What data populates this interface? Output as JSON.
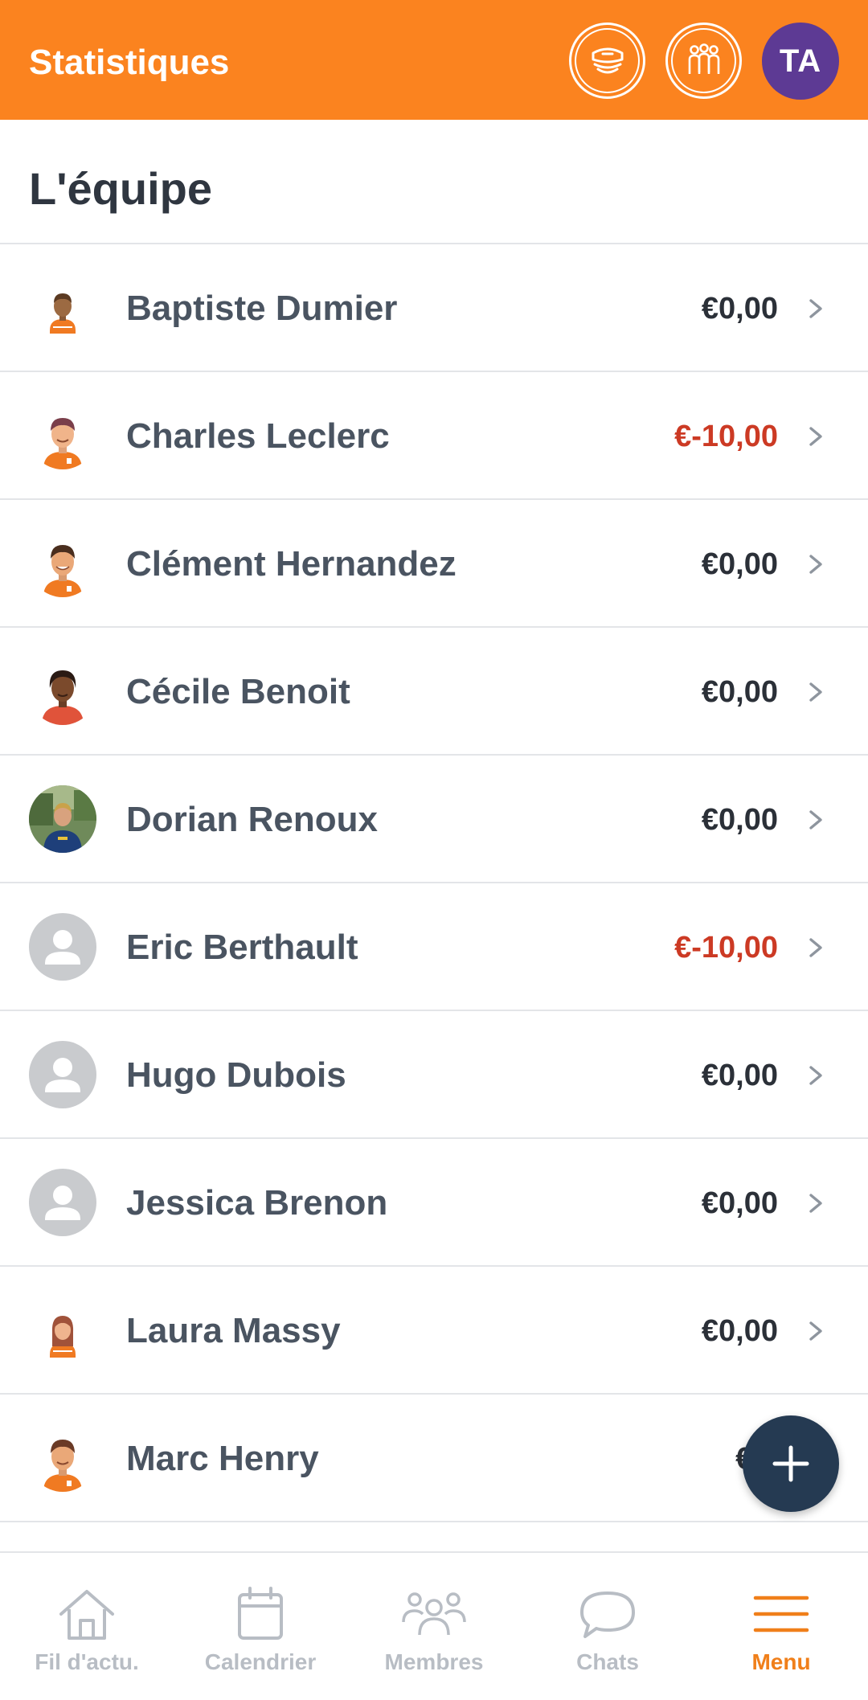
{
  "header": {
    "title": "Statistiques",
    "user_initials": "TA",
    "icons": [
      "coach-badge-icon",
      "team-group-icon"
    ]
  },
  "section": {
    "title": "L'équipe"
  },
  "members": [
    {
      "name": "Baptiste Dumier",
      "amount": "€0,00",
      "negative": false,
      "avatar": "player-avatar-small"
    },
    {
      "name": "Charles Leclerc",
      "amount": "€-10,00",
      "negative": true,
      "avatar": "player-avatar"
    },
    {
      "name": "Clément Hernandez",
      "amount": "€0,00",
      "negative": false,
      "avatar": "player-avatar"
    },
    {
      "name": "Cécile Benoit",
      "amount": "€0,00",
      "negative": false,
      "avatar": "player-avatar-red"
    },
    {
      "name": "Dorian Renoux",
      "amount": "€0,00",
      "negative": false,
      "avatar": "photo"
    },
    {
      "name": "Eric Berthault",
      "amount": "€-10,00",
      "negative": true,
      "avatar": "default-user"
    },
    {
      "name": "Hugo Dubois",
      "amount": "€0,00",
      "negative": false,
      "avatar": "default-user"
    },
    {
      "name": "Jessica Brenon",
      "amount": "€0,00",
      "negative": false,
      "avatar": "default-user"
    },
    {
      "name": "Laura Massy",
      "amount": "€0,00",
      "negative": false,
      "avatar": "player-avatar-female"
    },
    {
      "name": "Marc Henry",
      "amount": "€0,",
      "negative": false,
      "avatar": "player-avatar"
    }
  ],
  "nav": {
    "items": [
      {
        "label": "Fil d'actu.",
        "icon": "home-icon",
        "active": false
      },
      {
        "label": "Calendrier",
        "icon": "calendar-icon",
        "active": false
      },
      {
        "label": "Membres",
        "icon": "members-icon",
        "active": false
      },
      {
        "label": "Chats",
        "icon": "chat-icon",
        "active": false
      },
      {
        "label": "Menu",
        "icon": "menu-icon",
        "active": true
      }
    ]
  },
  "colors": {
    "brand": "#fb831f",
    "negative": "#cc3a24",
    "fab": "#253a52",
    "avatar_ta": "#5d3a94"
  }
}
